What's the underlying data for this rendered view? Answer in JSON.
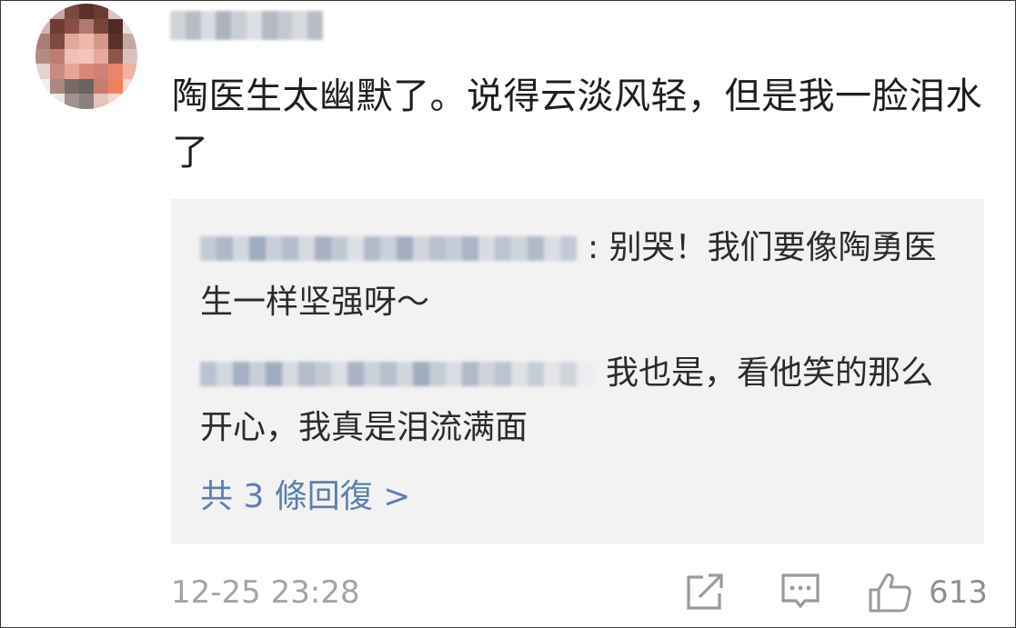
{
  "comment": {
    "text": "陶医生太幽默了。说得云淡风轻，但是我一脸泪水了",
    "timestamp": "12-25 23:28",
    "like_count": "613"
  },
  "replies": [
    {
      "text": ": 别哭！我们要像陶勇医生一样坚强呀～"
    },
    {
      "text": "我也是，看他笑的那么开心，我真是泪流满面"
    }
  ],
  "more_replies_label": "共 3 條回復 >",
  "icons": {
    "share": "share-icon",
    "comment": "comment-icon",
    "like": "thumbs-up-icon"
  },
  "colors": {
    "link": "#5b7fb0",
    "reply_bg": "#f2f2f2",
    "meta_text": "#a4a4a4"
  }
}
